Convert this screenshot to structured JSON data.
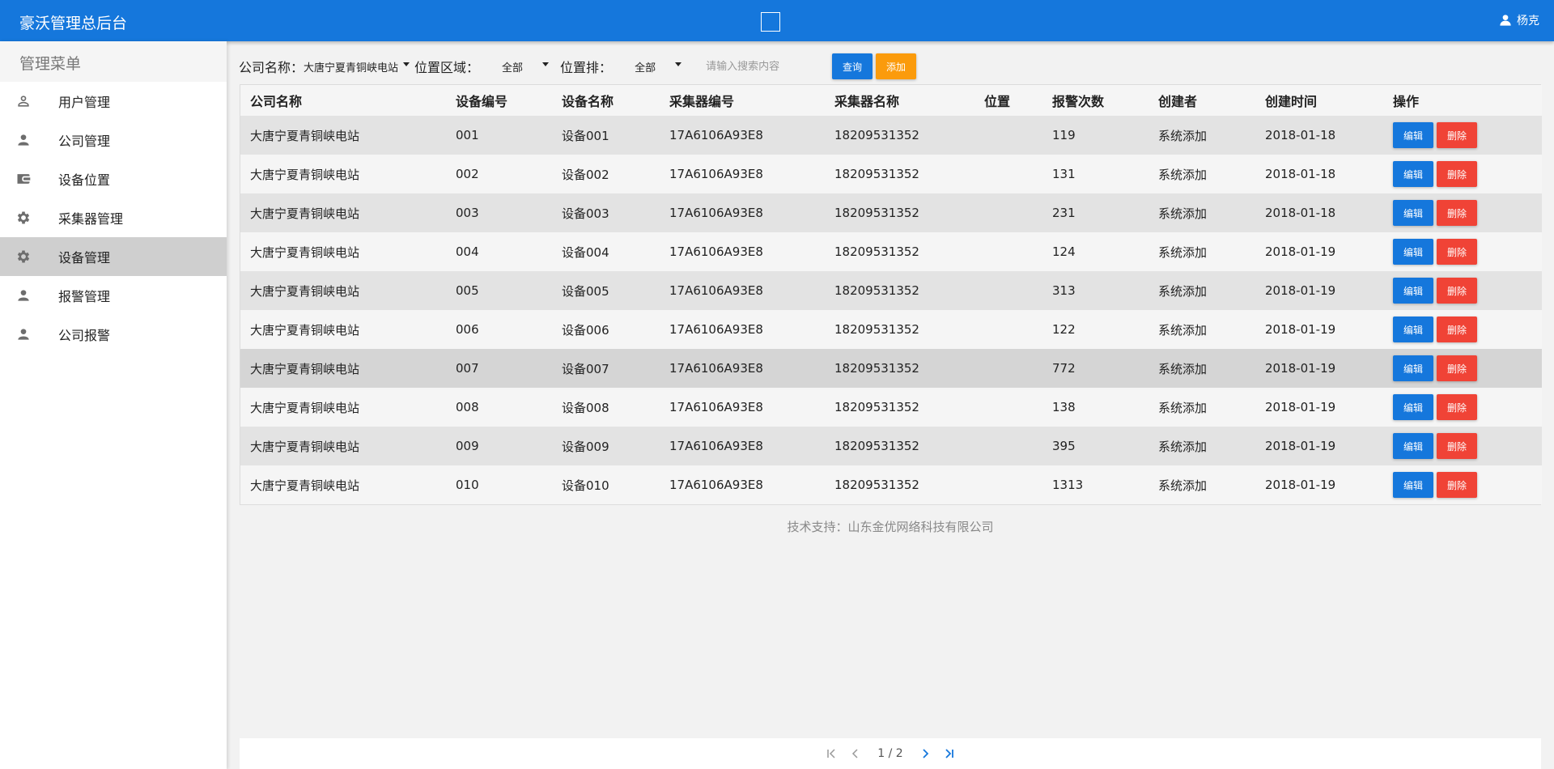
{
  "header": {
    "title": "豪沃管理总后台",
    "user": "杨克"
  },
  "sidebar": {
    "title": "管理菜单",
    "items": [
      {
        "label": "用户管理",
        "icon": "person-outline-icon"
      },
      {
        "label": "公司管理",
        "icon": "person-icon"
      },
      {
        "label": "设备位置",
        "icon": "wallet-icon"
      },
      {
        "label": "采集器管理",
        "icon": "gear-icon"
      },
      {
        "label": "设备管理",
        "icon": "gear-icon",
        "active": true
      },
      {
        "label": "报警管理",
        "icon": "person-icon"
      },
      {
        "label": "公司报警",
        "icon": "person-icon"
      }
    ]
  },
  "filter": {
    "company_label": "公司名称：",
    "company_value": "大唐宁夏青铜峡电站",
    "area_label": "位置区域：",
    "area_value": "全部",
    "row_label": "位置排：",
    "row_value": "全部",
    "search_placeholder": "请输入搜索内容",
    "query_label": "查询",
    "add_label": "添加"
  },
  "table": {
    "columns": [
      "公司名称",
      "设备编号",
      "设备名称",
      "采集器编号",
      "采集器名称",
      "位置",
      "报警次数",
      "创建者",
      "创建时间",
      "操作"
    ],
    "edit_label": "编辑",
    "delete_label": "删除",
    "rows": [
      {
        "company": "大唐宁夏青铜峡电站",
        "code": "001",
        "name": "设备001",
        "collector_code": "17A6106A93E8",
        "collector_name": "18209531352",
        "location": "",
        "alarms": "119",
        "creator": "系统添加",
        "created": "2018-01-18"
      },
      {
        "company": "大唐宁夏青铜峡电站",
        "code": "002",
        "name": "设备002",
        "collector_code": "17A6106A93E8",
        "collector_name": "18209531352",
        "location": "",
        "alarms": "131",
        "creator": "系统添加",
        "created": "2018-01-18"
      },
      {
        "company": "大唐宁夏青铜峡电站",
        "code": "003",
        "name": "设备003",
        "collector_code": "17A6106A93E8",
        "collector_name": "18209531352",
        "location": "",
        "alarms": "231",
        "creator": "系统添加",
        "created": "2018-01-18"
      },
      {
        "company": "大唐宁夏青铜峡电站",
        "code": "004",
        "name": "设备004",
        "collector_code": "17A6106A93E8",
        "collector_name": "18209531352",
        "location": "",
        "alarms": "124",
        "creator": "系统添加",
        "created": "2018-01-19"
      },
      {
        "company": "大唐宁夏青铜峡电站",
        "code": "005",
        "name": "设备005",
        "collector_code": "17A6106A93E8",
        "collector_name": "18209531352",
        "location": "",
        "alarms": "313",
        "creator": "系统添加",
        "created": "2018-01-19"
      },
      {
        "company": "大唐宁夏青铜峡电站",
        "code": "006",
        "name": "设备006",
        "collector_code": "17A6106A93E8",
        "collector_name": "18209531352",
        "location": "",
        "alarms": "122",
        "creator": "系统添加",
        "created": "2018-01-19"
      },
      {
        "company": "大唐宁夏青铜峡电站",
        "code": "007",
        "name": "设备007",
        "collector_code": "17A6106A93E8",
        "collector_name": "18209531352",
        "location": "",
        "alarms": "772",
        "creator": "系统添加",
        "created": "2018-01-19"
      },
      {
        "company": "大唐宁夏青铜峡电站",
        "code": "008",
        "name": "设备008",
        "collector_code": "17A6106A93E8",
        "collector_name": "18209531352",
        "location": "",
        "alarms": "138",
        "creator": "系统添加",
        "created": "2018-01-19"
      },
      {
        "company": "大唐宁夏青铜峡电站",
        "code": "009",
        "name": "设备009",
        "collector_code": "17A6106A93E8",
        "collector_name": "18209531352",
        "location": "",
        "alarms": "395",
        "creator": "系统添加",
        "created": "2018-01-19"
      },
      {
        "company": "大唐宁夏青铜峡电站",
        "code": "010",
        "name": "设备010",
        "collector_code": "17A6106A93E8",
        "collector_name": "18209531352",
        "location": "",
        "alarms": "1313",
        "creator": "系统添加",
        "created": "2018-01-19"
      }
    ]
  },
  "footer": {
    "support": "技术支持：山东金优网络科技有限公司"
  },
  "pager": {
    "pages": "1 / 2"
  },
  "colors": {
    "primary": "#1577dc",
    "add": "#fb9b0c",
    "delete": "#f04336"
  }
}
